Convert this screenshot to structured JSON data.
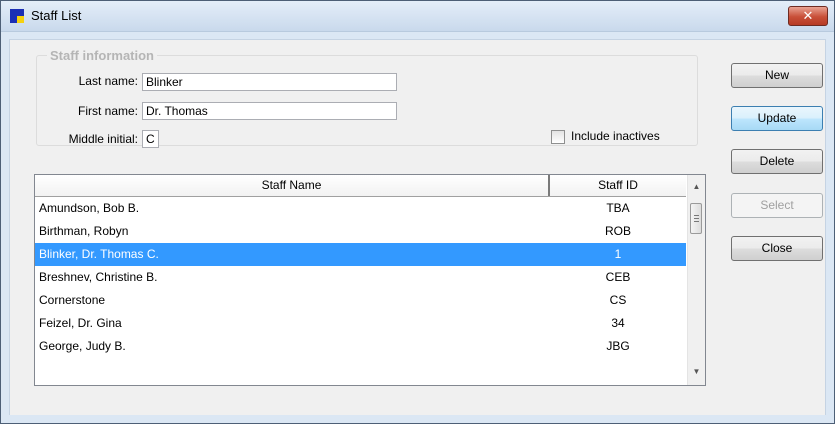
{
  "window": {
    "title": "Staff List",
    "close_glyph": "✕",
    "icon": "app-icon"
  },
  "staff_info": {
    "legend": "Staff information",
    "last_name_label": "Last name:",
    "last_name_value": "Blinker",
    "first_name_label": "First name:",
    "first_name_value": "Dr. Thomas",
    "middle_initial_label": "Middle initial:",
    "middle_initial_value": "C",
    "include_inactives_label": "Include inactives",
    "include_inactives_checked": false
  },
  "list": {
    "columns": [
      "Staff Name",
      "Staff ID"
    ],
    "rows": [
      {
        "name": "Amundson, Bob  B.",
        "id": "TBA"
      },
      {
        "name": "Birthman, Robyn",
        "id": "ROB"
      },
      {
        "name": "Blinker, Dr. Thomas  C.",
        "id": "1"
      },
      {
        "name": "Breshnev, Christine  B.",
        "id": "CEB"
      },
      {
        "name": "Cornerstone",
        "id": "CS"
      },
      {
        "name": "Feizel, Dr. Gina",
        "id": "34"
      },
      {
        "name": "George, Judy  B.",
        "id": "JBG"
      }
    ],
    "selected_row": 2,
    "scroll_up": "▲",
    "scroll_down": "▼"
  },
  "buttons": {
    "new": "New",
    "update": "Update",
    "delete": "Delete",
    "select": "Select",
    "close": "Close"
  }
}
